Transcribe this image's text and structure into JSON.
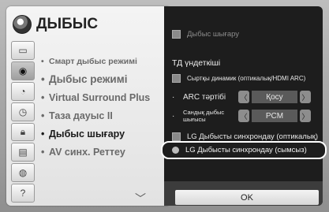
{
  "menu": {
    "title": "ДЫБЫС",
    "items": [
      {
        "label": "Смарт дыбыс режимі",
        "style": "small"
      },
      {
        "label": "Дыбыс режимі",
        "style": "big"
      },
      {
        "label": "Virtual Surround Plus",
        "style": "normal"
      },
      {
        "label": "Таза дауыс II",
        "style": "normal"
      },
      {
        "label": "Дыбыс шығару",
        "style": "normal",
        "current": true
      },
      {
        "label": "AV синх. Реттеу",
        "style": "normal"
      }
    ],
    "more_icon": "chevron-down-icon"
  },
  "panel": {
    "header_option": "Дыбыс шығару",
    "section_label": "ТД үндеткіші",
    "external_speaker": "Сыртқы динамик (оптикалық/HDMI ARC)",
    "arc_label": "ARC тәртібі",
    "arc_value": "Қосу",
    "digital_label": "Сандық дыбыс шығысы",
    "digital_value": "PCM",
    "lg_optical": "LG Дыбысты синхрондау (оптикалық)",
    "lg_wireless": "LG Дыбысты синхрондау (сымсыз)",
    "ok_label": "OK"
  }
}
